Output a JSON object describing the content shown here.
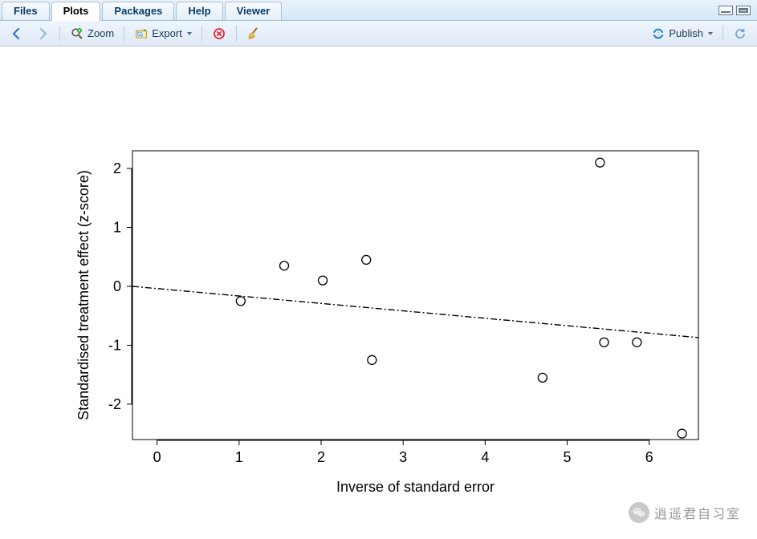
{
  "tabs": {
    "items": [
      {
        "label": "Files",
        "active": false
      },
      {
        "label": "Plots",
        "active": true
      },
      {
        "label": "Packages",
        "active": false
      },
      {
        "label": "Help",
        "active": false
      },
      {
        "label": "Viewer",
        "active": false
      }
    ]
  },
  "toolbar": {
    "zoom_label": "Zoom",
    "export_label": "Export",
    "publish_label": "Publish"
  },
  "watermark": {
    "text": "逍遥君自习室"
  },
  "chart_data": {
    "type": "scatter",
    "xlabel": "Inverse of standard error",
    "ylabel": "Standardised treatment effect (z-score)",
    "xlim": [
      -0.3,
      6.6
    ],
    "ylim": [
      -2.6,
      2.3
    ],
    "xticks": [
      0,
      1,
      2,
      3,
      4,
      5,
      6
    ],
    "yticks": [
      -2,
      -1,
      0,
      1,
      2
    ],
    "points": [
      {
        "x": 1.02,
        "y": -0.25
      },
      {
        "x": 1.55,
        "y": 0.35
      },
      {
        "x": 2.02,
        "y": 0.1
      },
      {
        "x": 2.55,
        "y": 0.45
      },
      {
        "x": 2.62,
        "y": -1.25
      },
      {
        "x": 4.7,
        "y": -1.55
      },
      {
        "x": 5.4,
        "y": 2.1
      },
      {
        "x": 5.45,
        "y": -0.95
      },
      {
        "x": 5.85,
        "y": -0.95
      },
      {
        "x": 6.4,
        "y": -2.5
      }
    ],
    "fit_line": {
      "x1": -0.3,
      "y1": 0.0,
      "x2": 6.6,
      "y2": -0.87,
      "style": "dash-dot"
    }
  }
}
